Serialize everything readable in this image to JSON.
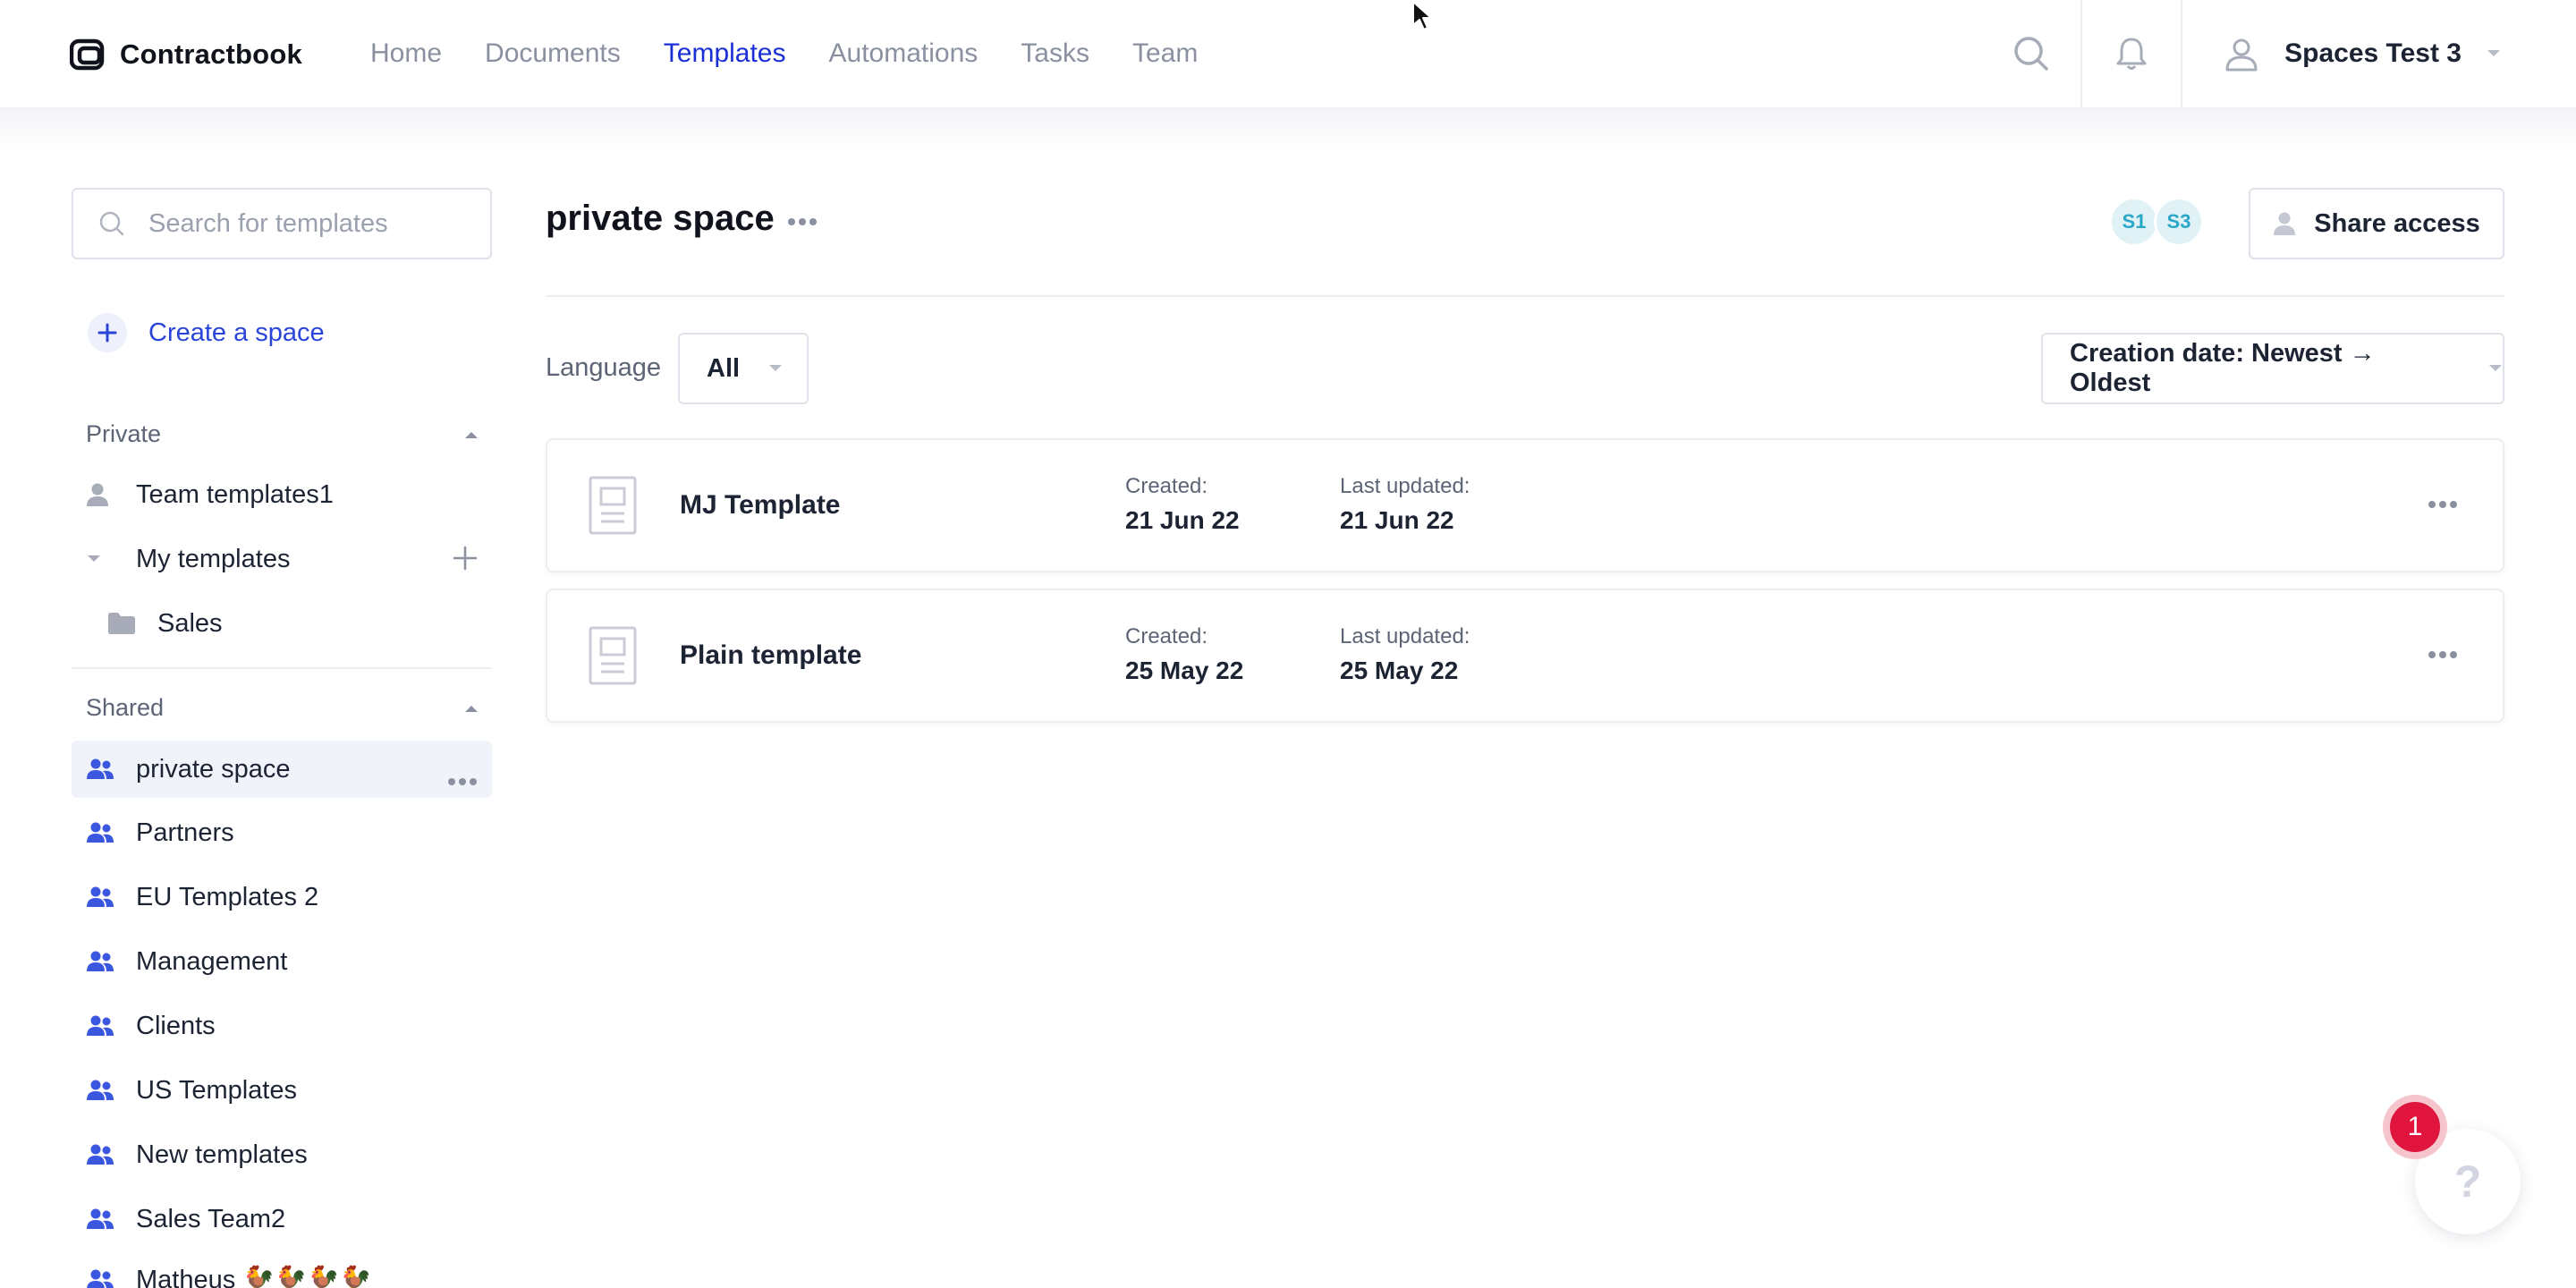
{
  "app": {
    "name": "Contractbook"
  },
  "nav": {
    "items": [
      {
        "label": "Home",
        "active": false
      },
      {
        "label": "Documents",
        "active": false
      },
      {
        "label": "Templates",
        "active": true
      },
      {
        "label": "Automations",
        "active": false
      },
      {
        "label": "Tasks",
        "active": false
      },
      {
        "label": "Team",
        "active": false
      }
    ],
    "user_name": "Spaces Test 3"
  },
  "sidebar": {
    "search_placeholder": "Search for templates",
    "create_space_label": "Create a space",
    "private": {
      "header": "Private",
      "items": [
        {
          "label": "Team templates1",
          "icon": "user-icon"
        },
        {
          "label": "My templates",
          "icon": "caret-down-icon"
        },
        {
          "label": "Sales",
          "icon": "folder-icon"
        }
      ]
    },
    "shared": {
      "header": "Shared",
      "items": [
        {
          "label": "private space",
          "selected": true
        },
        {
          "label": "Partners"
        },
        {
          "label": "EU Templates 2"
        },
        {
          "label": "Management"
        },
        {
          "label": "Clients"
        },
        {
          "label": "US Templates"
        },
        {
          "label": "New templates"
        },
        {
          "label": "Sales Team2"
        },
        {
          "label": "Matheus 🐓🐓🐓🐓"
        }
      ]
    }
  },
  "main": {
    "title": "private space",
    "avatars": [
      "S1",
      "S3"
    ],
    "share_label": "Share access",
    "language_label": "Language",
    "language_value": "All",
    "sort_value": "Creation date: Newest → Oldest",
    "templates": [
      {
        "name": "MJ Template",
        "created_label": "Created:",
        "created": "21 Jun 22",
        "updated_label": "Last updated:",
        "updated": "21 Jun 22"
      },
      {
        "name": "Plain template",
        "created_label": "Created:",
        "created": "25 May 22",
        "updated_label": "Last updated:",
        "updated": "25 May 22"
      }
    ]
  },
  "help": {
    "badge_count": "1",
    "icon_text": "?"
  },
  "colors": {
    "accent": "#1a2fd6",
    "link": "#2a45d8",
    "badge": "#e1143d",
    "avatar_text": "#2aa6c7"
  }
}
